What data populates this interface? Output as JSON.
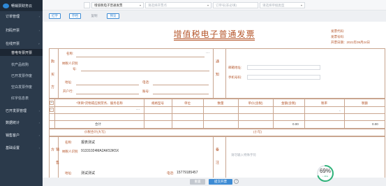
{
  "app": {
    "name": "畅销票财务云"
  },
  "sidebar": {
    "items": [
      {
        "label": "订单管理",
        "kind": "group"
      },
      {
        "label": "扫码开票",
        "kind": "group"
      },
      {
        "label": "在线开票",
        "kind": "group"
      },
      {
        "label": "普电专票开票",
        "kind": "sub-active"
      },
      {
        "label": "农产品收购",
        "kind": "sub"
      },
      {
        "label": "已开发票作废",
        "kind": "sub"
      },
      {
        "label": "空白发票作废",
        "kind": "sub"
      },
      {
        "label": "红字信息表",
        "kind": "sub"
      },
      {
        "label": "已开发票管理",
        "kind": "group"
      },
      {
        "label": "数据统计",
        "kind": "group"
      },
      {
        "label": "销售客户",
        "kind": "group"
      },
      {
        "label": "基础设置",
        "kind": "group"
      }
    ]
  },
  "topbar": {
    "invoice_type": "增值税电子普通发票",
    "invoice_type_placeholder": "请选择开票点",
    "order_placeholder": "订单号(非必填)",
    "status_placeholder": "请选择单据类型"
  },
  "toolbar": {
    "btn_red": "红字",
    "btn_draft": "存档",
    "btn_copy": "复制",
    "btn_preview": "预览"
  },
  "invoice": {
    "title": "增值税电子普通发票",
    "invoice_code_label": "发票代码:",
    "invoice_number_label": "发票号码:",
    "issue_date_label": "开票日期：",
    "issue_date": "2021年09月24日",
    "buyer_side": "购 买 方",
    "buyer": {
      "name_label": "名称:",
      "taxid_label": "纳税人识别",
      "taxid_label2": "号:",
      "address_label": "地址:",
      "phone_label": "电话:",
      "bank_label": "开户行:",
      "account_label": "账号:"
    },
    "notice_side": "通 知",
    "notice": {
      "email_label": "邮箱地址:",
      "mobile_label": "手机号码:"
    },
    "table": {
      "headers": [
        "*项目*货物或应税劳务、服务名称",
        "规格型号",
        "单位",
        "数量",
        "单价(含税)",
        "金额(含税)",
        "税率",
        "税额"
      ],
      "subtotal_label": "合计",
      "subtotal_amount": "0.00",
      "subtotal_tax": "0.00"
    },
    "total": {
      "label": "价税合计(大写)",
      "small_label": "(小写)"
    },
    "seller_side": "销 售 方",
    "seller": {
      "name_label": "名称:",
      "name": "报表测试",
      "taxid_label": "纳税人识别",
      "taxid": "91331024MA2AK53K5X",
      "address_label": "地址:",
      "address": "测试测试",
      "phone_label": "电话:",
      "phone": "15779185457"
    },
    "remark_side": "备 注",
    "remark_placeholder": "请勿输入特殊字符"
  },
  "actions": {
    "reset": "重置",
    "submit": "提交开票"
  },
  "gauge": {
    "percent": 69,
    "percent_label": "69%",
    "sub_label": "↓ 4K/s",
    "color": "#2fb37a"
  },
  "colors": {
    "accent": "#3d8bd4",
    "invoice": "#b5562b",
    "sidebar": "#2b3a4b"
  }
}
